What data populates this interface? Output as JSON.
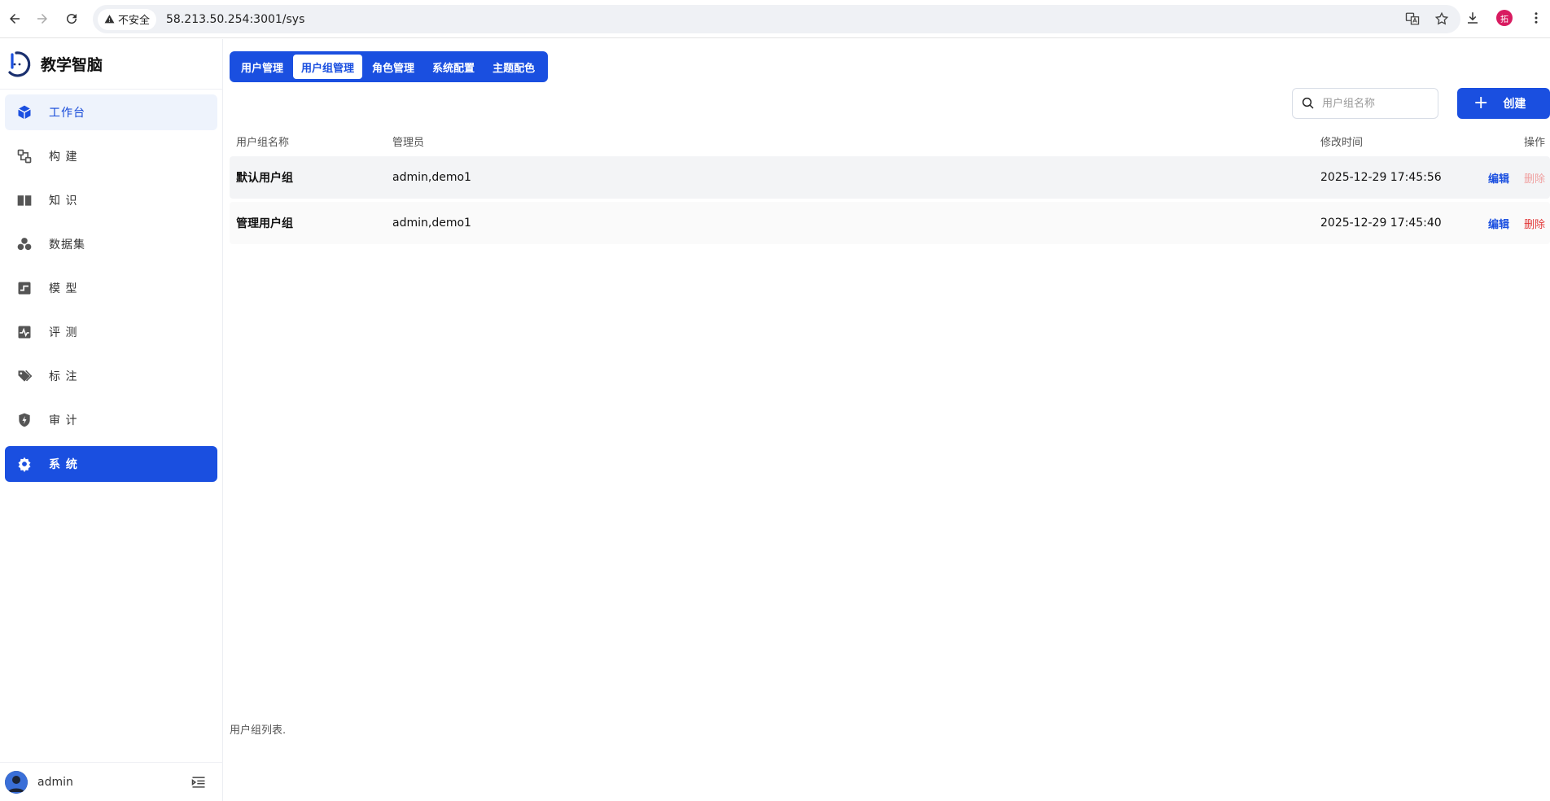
{
  "browser": {
    "insecure_label": "不安全",
    "url": "58.213.50.254:3001/sys",
    "profile_initial": "拓"
  },
  "brand": {
    "name": "教学智脑"
  },
  "sidebar": {
    "items": [
      {
        "label": "工作台",
        "icon": "cube-icon"
      },
      {
        "label": "构 建",
        "icon": "build-icon"
      },
      {
        "label": "知 识",
        "icon": "book-icon"
      },
      {
        "label": "数据集",
        "icon": "dataset-icon"
      },
      {
        "label": "模 型",
        "icon": "model-icon"
      },
      {
        "label": "评 测",
        "icon": "evaluate-icon"
      },
      {
        "label": "标 注",
        "icon": "tag-icon"
      },
      {
        "label": "审 计",
        "icon": "shield-icon"
      },
      {
        "label": "系 统",
        "icon": "gear-icon"
      }
    ],
    "footer_user": "admin"
  },
  "tabs": [
    {
      "label": "用户管理"
    },
    {
      "label": "用户组管理"
    },
    {
      "label": "角色管理"
    },
    {
      "label": "系统配置"
    },
    {
      "label": "主题配色"
    }
  ],
  "search": {
    "placeholder": "用户组名称"
  },
  "create_button": {
    "label": "创建"
  },
  "table": {
    "headers": {
      "name": "用户组名称",
      "admins": "管理员",
      "modified": "修改时间",
      "ops": "操作"
    },
    "rows": [
      {
        "name": "默认用户组",
        "admins": "admin,demo1",
        "modified": "2025-12-29 17:45:56",
        "edit": "编辑",
        "delete": "删除"
      },
      {
        "name": "管理用户组",
        "admins": "admin,demo1",
        "modified": "2025-12-29 17:45:40",
        "edit": "编辑",
        "delete": "删除"
      }
    ],
    "caption": "用户组列表."
  },
  "colors": {
    "accent": "#1a4fe0",
    "danger": "#e23838"
  }
}
